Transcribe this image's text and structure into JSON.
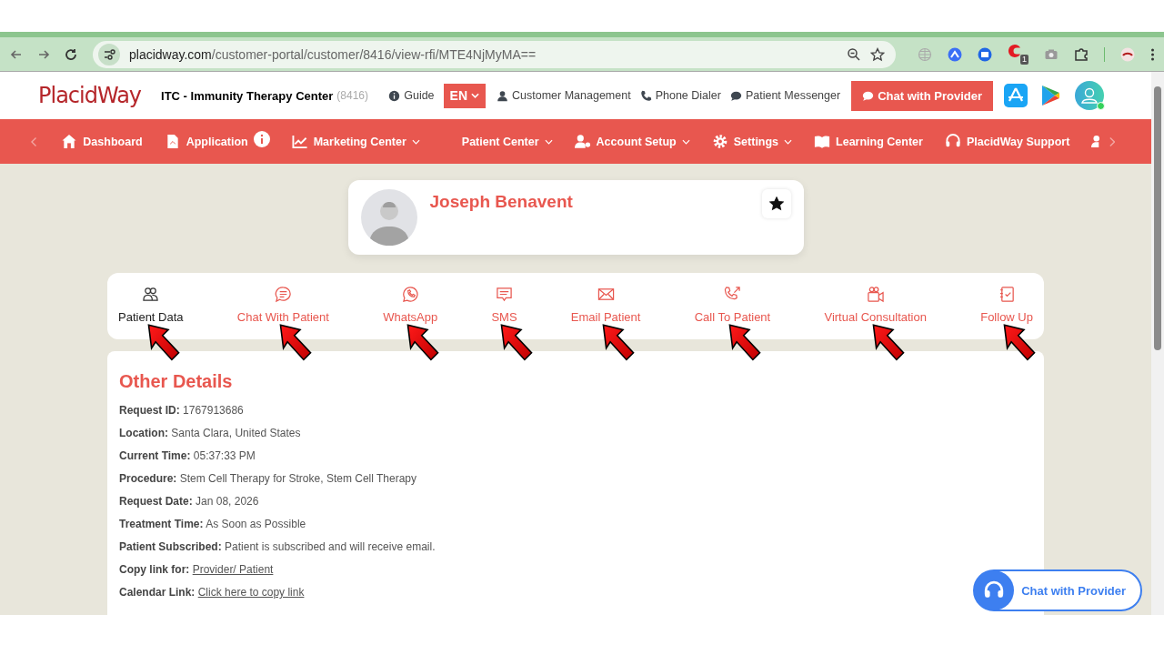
{
  "browser": {
    "url_domain": "placidway.com",
    "url_path": "/customer-portal/customer/8416/view-rfi/MTE4NjMyMA==",
    "extension_badge": "1"
  },
  "header": {
    "logo": "PlacidWay",
    "center_name": "ITC - Immunity Therapy Center",
    "center_id": "(8416)",
    "guide": "Guide",
    "language": "EN",
    "links": [
      {
        "kind": "user",
        "label": "Customer Management"
      },
      {
        "kind": "phone",
        "label": "Phone Dialer"
      },
      {
        "kind": "chat",
        "label": "Patient Messenger"
      }
    ],
    "chat_button": "Chat with Provider",
    "online": true
  },
  "nav": [
    {
      "kind": "home",
      "label": "Dashboard",
      "dropdown": false,
      "info": false
    },
    {
      "kind": "file",
      "label": "Application",
      "dropdown": false,
      "info": true
    },
    {
      "kind": "chart",
      "label": "Marketing Center",
      "dropdown": true,
      "info": false
    },
    {
      "kind": "none",
      "label": "Patient Center",
      "dropdown": true,
      "info": false
    },
    {
      "kind": "users",
      "label": "Account Setup",
      "dropdown": true,
      "info": false
    },
    {
      "kind": "gear",
      "label": "Settings",
      "dropdown": true,
      "info": false
    },
    {
      "kind": "book",
      "label": "Learning Center",
      "dropdown": false,
      "info": false
    },
    {
      "kind": "headset",
      "label": "PlacidWay Support",
      "dropdown": false,
      "info": false
    }
  ],
  "patient": {
    "name": "Joseph Benavent",
    "favorite": true
  },
  "actions": [
    {
      "kind": "users",
      "label": "Patient Data",
      "selected": true,
      "marked": true
    },
    {
      "kind": "chat",
      "label": "Chat With Patient",
      "selected": false,
      "marked": true
    },
    {
      "kind": "whatsapp",
      "label": "WhatsApp",
      "selected": false,
      "marked": true
    },
    {
      "kind": "sms",
      "label": "SMS",
      "selected": false,
      "marked": true
    },
    {
      "kind": "mail",
      "label": "Email Patient",
      "selected": false,
      "marked": true
    },
    {
      "kind": "phone",
      "label": "Call To Patient",
      "selected": false,
      "marked": true
    },
    {
      "kind": "video",
      "label": "Virtual Consultation",
      "selected": false,
      "marked": true
    },
    {
      "kind": "followup",
      "label": "Follow Up",
      "selected": false,
      "marked": true
    }
  ],
  "details": {
    "title": "Other Details",
    "rows": [
      {
        "kind": "text",
        "label": "Request ID:",
        "value": "1767913686"
      },
      {
        "kind": "text",
        "label": "Location:",
        "value": "Santa Clara, United States"
      },
      {
        "kind": "text",
        "label": "Current Time:",
        "value": "05:37:33 PM"
      },
      {
        "kind": "text",
        "label": "Procedure:",
        "value": "Stem Cell Therapy for Stroke, Stem Cell Therapy"
      },
      {
        "kind": "text",
        "label": "Request Date:",
        "value": "Jan 08, 2026"
      },
      {
        "kind": "text",
        "label": "Treatment Time:",
        "value": "As Soon as Possible"
      },
      {
        "kind": "text",
        "label": "Patient Subscribed:",
        "value": "Patient is subscribed and will receive email."
      },
      {
        "kind": "link",
        "label": "Copy link for:",
        "value": "Provider/ Patient"
      },
      {
        "kind": "link",
        "label": "Calendar Link:",
        "value": "Click here to copy link"
      }
    ]
  },
  "floating_chat": "Chat with Provider"
}
